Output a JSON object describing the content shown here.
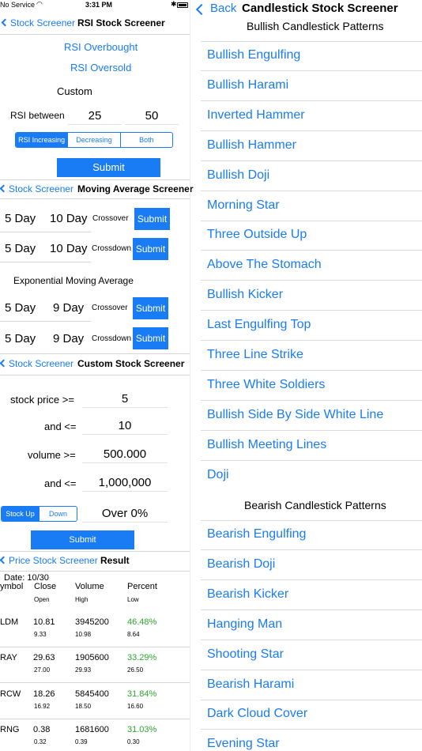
{
  "status_bar": {
    "carrier": "No Service",
    "time": "3:31 PM"
  },
  "rsi": {
    "back": "Stock Screener",
    "title": "RSI Stock Screener",
    "overbought": "RSI Overbought",
    "oversold": "RSI Oversold",
    "custom": "Custom",
    "between_label": "RSI between",
    "low": "25",
    "high": "50",
    "segments": [
      "RSI Increasing",
      "Decreasing",
      "Both"
    ],
    "submit": "Submit"
  },
  "ma": {
    "back": "Stock Screener",
    "title": "Moving Average Screener",
    "rows": [
      {
        "a": "5 Day",
        "b": "10 Day",
        "kind": "Crossover",
        "submit": "Submit"
      },
      {
        "a": "5 Day",
        "b": "10 Day",
        "kind": "Crossdown",
        "submit": "Submit"
      }
    ],
    "ema_title": "Exponential Moving Average",
    "ema_rows": [
      {
        "a": "5 Day",
        "b": "9 Day",
        "kind": "Crossover",
        "submit": "Submit"
      },
      {
        "a": "5 Day",
        "b": "9 Day",
        "kind": "Crossdown",
        "submit": "Submit"
      }
    ]
  },
  "custom": {
    "back": "Stock Screener",
    "title": "Custom Stock Screener",
    "price_min_label": "stock price >=",
    "price_min": "5",
    "price_max_label": "and <=",
    "price_max": "10",
    "vol_min_label": "volume >=",
    "vol_min": "500.000",
    "vol_max_label": "and <=",
    "vol_max": "1,000,000",
    "segments": [
      "Stock Up",
      "Down"
    ],
    "over": "Over 0%",
    "submit": "Submit"
  },
  "result": {
    "back": "Price Stock Screener",
    "title": "Result",
    "date": "Date: 10/30",
    "headers": {
      "symbol": "ymbol",
      "close": "Close",
      "open": "Open",
      "volume": "Volume",
      "high": "High",
      "percent": "Percent",
      "low": "Low"
    },
    "rows": [
      {
        "symbol": "LDM",
        "close": "10.81",
        "open": "9.33",
        "volume": "3945200",
        "high": "10.98",
        "percent": "46.48%",
        "low": "8.64"
      },
      {
        "symbol": "RAY",
        "close": "29.63",
        "open": "27.00",
        "volume": "1905600",
        "high": "29.93",
        "percent": "33.29%",
        "low": "26.50"
      },
      {
        "symbol": "RCW",
        "close": "18.26",
        "open": "16.92",
        "volume": "5845400",
        "high": "18.50",
        "percent": "31.84%",
        "low": "16.60"
      },
      {
        "symbol": "RNG",
        "close": "0.38",
        "open": "0.32",
        "volume": "1681600",
        "high": "0.39",
        "percent": "31.03%",
        "low": "0.30"
      }
    ],
    "percent_color": "#2ea52e"
  },
  "candlestick": {
    "back": "Back",
    "title": "Candlestick Stock Screener",
    "bullish_header": "Bullish Candlestick Patterns",
    "bullish": [
      "Bullish Engulfing",
      "Bullish Harami",
      "Inverted Hammer",
      "Bullish Hammer",
      "Bullish Doji",
      "Morning Star",
      "Three Outside Up",
      "Above The Stomach",
      "Bullish Kicker",
      "Last Engulfing Top",
      "Three Line Strike",
      "Three White Soldiers",
      "Bullish Side By Side White Line",
      "Bullish Meeting Lines",
      "Doji"
    ],
    "bearish_header": "Bearish Candlestick Patterns",
    "bearish": [
      "Bearish Engulfing",
      "Bearish Doji",
      "Bearish Kicker",
      "Hanging Man",
      "Shooting Star",
      "Bearish Harami",
      "Dark Cloud Cover",
      "Evening Star"
    ]
  },
  "colors": {
    "accent": "#1a7cf5",
    "separator": "#d6d6da"
  }
}
